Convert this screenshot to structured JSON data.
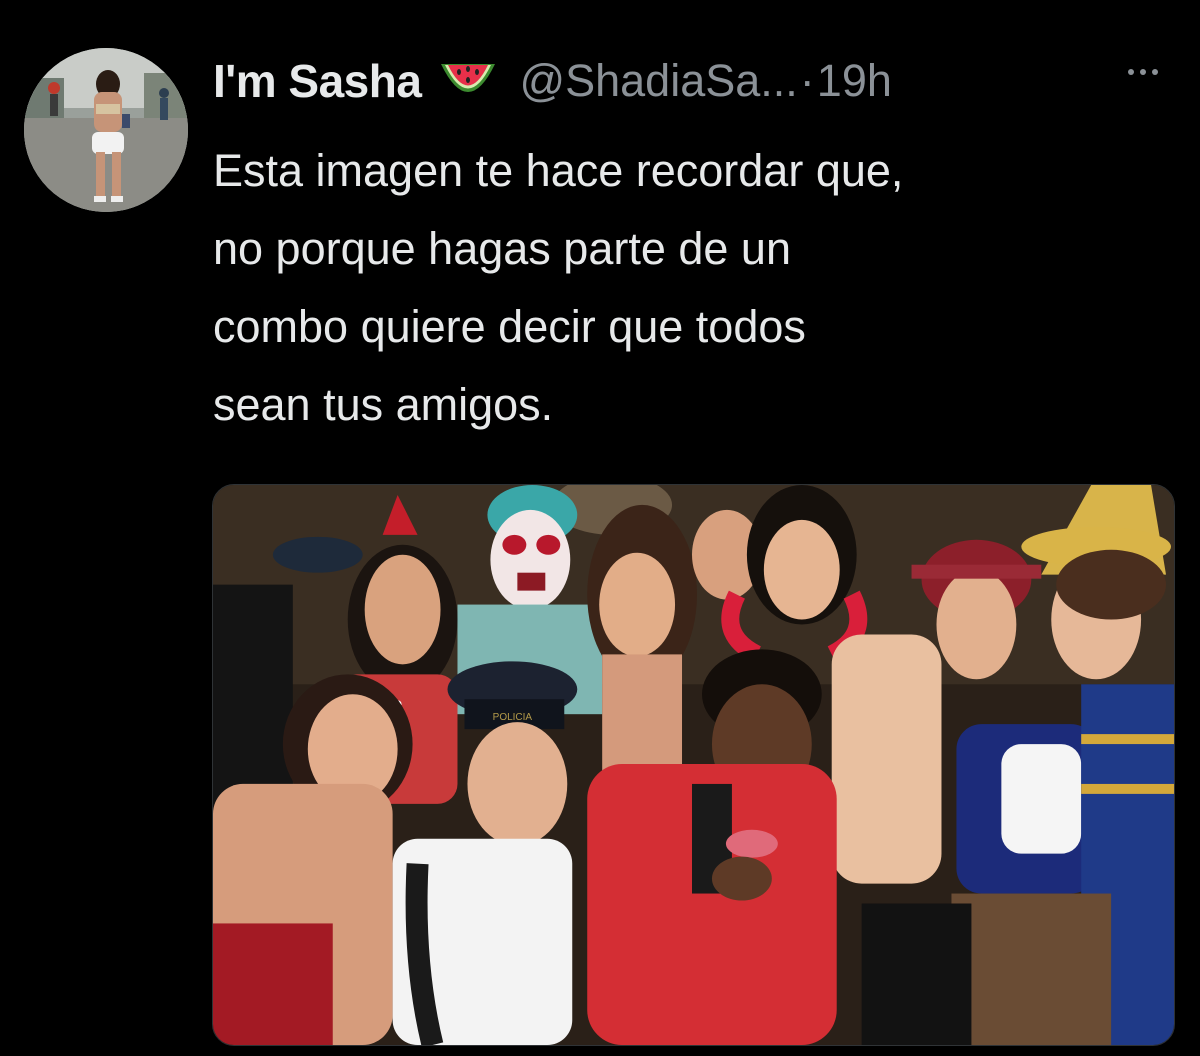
{
  "tweet": {
    "author": {
      "display_name": "I'm Sasha",
      "emoji_icon": "watermelon-emoji",
      "handle": "@ShadiaSa...",
      "separator": "·",
      "time": "19h"
    },
    "more_icon": "more-options-icon",
    "text_lines": [
      "Esta imagen te hace recordar que,",
      "no porque hagas parte de un",
      "combo quiere decir que todos",
      "sean tus amigos."
    ],
    "media": {
      "type": "photo",
      "police_cap_text": "POLICIA"
    }
  },
  "colors": {
    "background": "#000000",
    "primary_text": "#e7e9ea",
    "secondary_text": "#8b9197"
  }
}
